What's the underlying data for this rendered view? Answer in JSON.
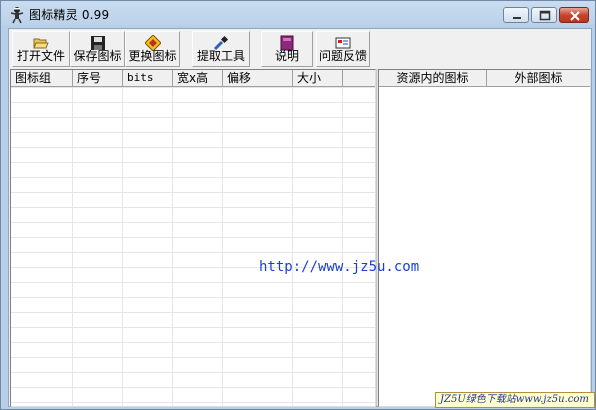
{
  "window": {
    "title": "图标精灵 0.99"
  },
  "toolbar": {
    "buttons": [
      {
        "label": "打开文件",
        "icon": "folder-open-icon"
      },
      {
        "label": "保存图标",
        "icon": "floppy-disk-icon"
      },
      {
        "label": "更换图标",
        "icon": "swap-diamond-icon"
      },
      {
        "label": "提取工具",
        "icon": "eyedropper-icon"
      },
      {
        "label": "说明",
        "icon": "help-book-icon"
      },
      {
        "label": "问题反馈",
        "icon": "feedback-envelope-icon"
      }
    ]
  },
  "icon_list": {
    "columns": [
      "图标组",
      "序号",
      "bits",
      "宽x高",
      "偏移",
      "大小"
    ],
    "rows": []
  },
  "resource_list": {
    "columns": [
      "资源内的图标",
      "外部图标"
    ],
    "rows": []
  },
  "overlay": {
    "url": "http://www.jz5u.com",
    "watermark": "JZ5U绿色下载站www.jz5u.com"
  },
  "colors": {
    "url_text": "#1a3fd6",
    "titlebar": "#bcd2ea",
    "close_button": "#c8452e"
  }
}
